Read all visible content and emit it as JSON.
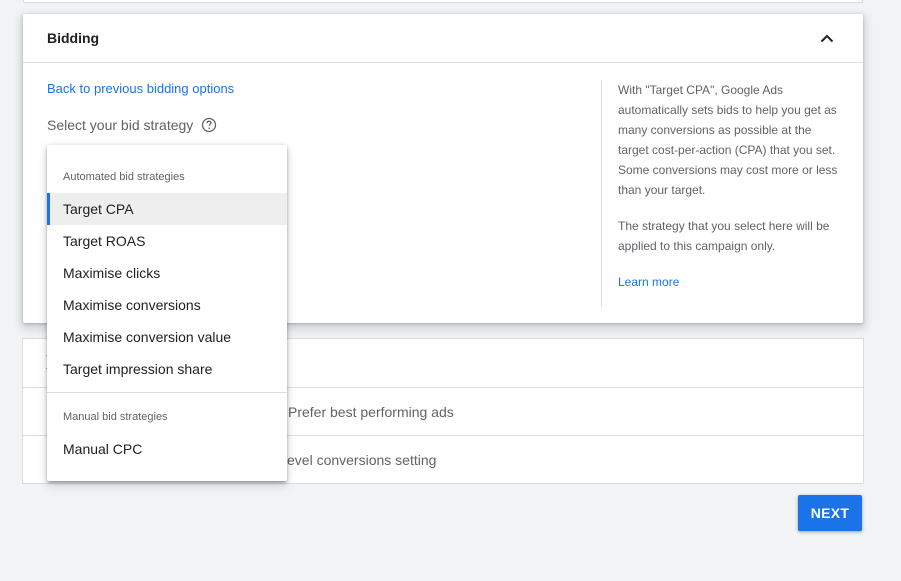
{
  "bidding": {
    "title": "Bidding",
    "back_link": "Back to previous bidding options",
    "select_label": "Select your bid strategy",
    "info": {
      "paragraph1": "With \"Target CPA\", Google Ads automatically sets bids to help you get as many conversions as possible at the target cost-per-action (CPA) that you set. Some conversions may cost more or less than your target.",
      "paragraph2": "The strategy that you select here will be applied to this campaign only.",
      "learn_more": "Learn more"
    }
  },
  "dropdown": {
    "automated_header": "Automated bid strategies",
    "automated_items": [
      {
        "label": "Target CPA",
        "selected": true
      },
      {
        "label": "Target ROAS"
      },
      {
        "label": "Maximise clicks"
      },
      {
        "label": "Maximise conversions"
      },
      {
        "label": "Maximise conversion value"
      },
      {
        "label": "Target impression share"
      }
    ],
    "manual_header": "Manual bid strategies",
    "manual_items": [
      {
        "label": "Manual CPC"
      }
    ]
  },
  "settings": {
    "rows": [
      {
        "text": "Prefer best performing ads"
      },
      {
        "text": "evel conversions setting"
      }
    ]
  },
  "footer": {
    "next_label": "NEXT"
  },
  "colors": {
    "accent": "#1a73e8",
    "selected_bg": "#eeeeee",
    "page_bg": "#f1f3f4"
  }
}
